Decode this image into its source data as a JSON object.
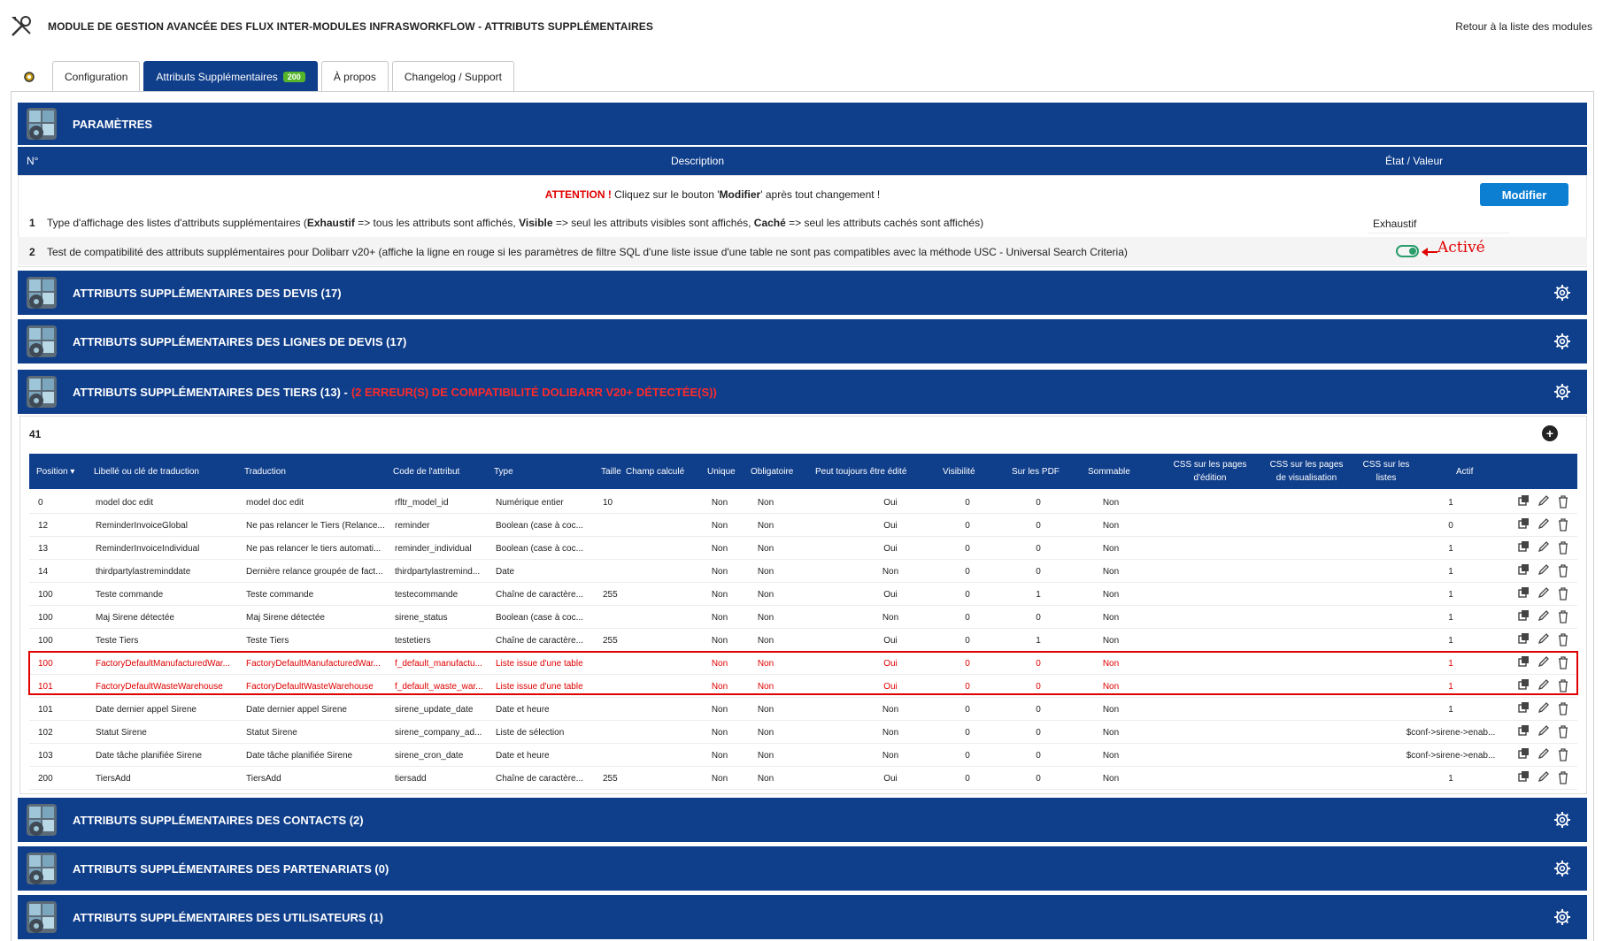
{
  "header": {
    "title": "MODULE DE GESTION AVANCÉE DES FLUX INTER-MODULES INFRASWORKFLOW - ATTRIBUTS SUPPLÉMENTAIRES",
    "back_link": "Retour à la liste des modules"
  },
  "tabs": [
    {
      "label": "Configuration"
    },
    {
      "label": "Attributs Supplémentaires",
      "badge": "200"
    },
    {
      "label": "À propos"
    },
    {
      "label": "Changelog / Support"
    }
  ],
  "params": {
    "title": "PARAMÈTRES",
    "col_num": "N°",
    "col_desc": "Description",
    "col_state": "État / Valeur",
    "attention_prefix": "ATTENTION !",
    "attention_a": " Cliquez sur le bouton '",
    "attention_b": "Modifier",
    "attention_c": "' après tout changement !",
    "modify_button": "Modifier",
    "row1": {
      "num": "1",
      "p1": "Type d'affichage des listes d'attributs supplémentaires (",
      "b1": "Exhaustif",
      "p2": " => tous les attributs sont affichés, ",
      "b2": "Visible",
      "p3": " => seul les attributs visibles sont affichés, ",
      "b3": "Caché",
      "p4": " => seul les attributs cachés sont affichés)",
      "value": "Exhaustif"
    },
    "row2": {
      "num": "2",
      "desc": "Test de compatibilité des attributs supplémentaires pour Dolibarr v20+ (affiche la ligne en rouge si les paramètres de filtre SQL d'une liste issue d'une table ne sont pas compatibles avec la méthode USC - Universal Search Criteria)",
      "annotation": "Activé"
    }
  },
  "sections": {
    "devis": "ATTRIBUTS SUPPLÉMENTAIRES DES DEVIS (17)",
    "lignes_devis": "ATTRIBUTS SUPPLÉMENTAIRES DES LIGNES DE DEVIS (17)",
    "tiers": "ATTRIBUTS SUPPLÉMENTAIRES DES TIERS (13) -",
    "tiers_error": "(2 ERREUR(S) DE COMPATIBILITÉ DOLIBARR V20+ DÉTECTÉE(S))",
    "contacts": "ATTRIBUTS SUPPLÉMENTAIRES DES CONTACTS (2)",
    "partenariats": "ATTRIBUTS SUPPLÉMENTAIRES DES PARTENARIATS (0)",
    "utilisateurs": "ATTRIBUTS SUPPLÉMENTAIRES DES UTILISATEURS (1)"
  },
  "tiers_table": {
    "count": "41",
    "headers": {
      "position": "Position",
      "libelle": "Libellé ou clé de traduction",
      "traduction": "Traduction",
      "code": "Code de l'attribut",
      "type": "Type",
      "taille": "Taille",
      "calcule": "Champ calculé",
      "unique": "Unique",
      "obligatoire": "Obligatoire",
      "toujours": "Peut toujours être édité",
      "visibilite": "Visibilité",
      "pdf": "Sur les PDF",
      "sommable": "Sommable",
      "css_edit_1": "CSS sur les pages",
      "css_edit_2": "d'édition",
      "css_view_1": "CSS sur les pages",
      "css_view_2": "de visualisation",
      "css_list_1": "CSS sur les",
      "css_list_2": "listes",
      "actif": "Actif"
    },
    "rows": [
      {
        "pos": "0",
        "label": "model doc edit",
        "trad": "model doc edit",
        "code": "rfltr_model_id",
        "type": "Numérique entier",
        "size": "10",
        "unique": "Non",
        "required": "Non",
        "always": "Oui",
        "vis": "0",
        "pdf": "0",
        "sum": "Non",
        "css": "",
        "active": "1",
        "error": false
      },
      {
        "pos": "12",
        "label": "ReminderInvoiceGlobal",
        "trad": "Ne pas relancer le Tiers (Relance...",
        "code": "reminder",
        "type": "Boolean (case à coc...",
        "size": "",
        "unique": "Non",
        "required": "Non",
        "always": "Oui",
        "vis": "0",
        "pdf": "0",
        "sum": "Non",
        "css": "",
        "active": "0",
        "error": false
      },
      {
        "pos": "13",
        "label": "ReminderInvoiceIndividual",
        "trad": "Ne pas relancer le tiers automati...",
        "code": "reminder_individual",
        "type": "Boolean (case à coc...",
        "size": "",
        "unique": "Non",
        "required": "Non",
        "always": "Oui",
        "vis": "0",
        "pdf": "0",
        "sum": "Non",
        "css": "",
        "active": "1",
        "error": false
      },
      {
        "pos": "14",
        "label": "thirdpartylastreminddate",
        "trad": "Dernière relance groupée de fact...",
        "code": "thirdpartylastremind...",
        "type": "Date",
        "size": "",
        "unique": "Non",
        "required": "Non",
        "always": "Non",
        "vis": "0",
        "pdf": "0",
        "sum": "Non",
        "css": "",
        "active": "1",
        "error": false
      },
      {
        "pos": "100",
        "label": "Teste commande",
        "trad": "Teste commande",
        "code": "testecommande",
        "type": "Chaîne de caractère...",
        "size": "255",
        "unique": "Non",
        "required": "Non",
        "always": "Oui",
        "vis": "0",
        "pdf": "1",
        "sum": "Non",
        "css": "",
        "active": "1",
        "error": false
      },
      {
        "pos": "100",
        "label": "Maj Sirene détectée",
        "trad": "Maj Sirene détectée",
        "code": "sirene_status",
        "type": "Boolean (case à coc...",
        "size": "",
        "unique": "Non",
        "required": "Non",
        "always": "Non",
        "vis": "0",
        "pdf": "0",
        "sum": "Non",
        "css": "",
        "active": "1",
        "error": false
      },
      {
        "pos": "100",
        "label": "Teste Tiers",
        "trad": "Teste Tiers",
        "code": "testetiers",
        "type": "Chaîne de caractère...",
        "size": "255",
        "unique": "Non",
        "required": "Non",
        "always": "Oui",
        "vis": "0",
        "pdf": "1",
        "sum": "Non",
        "css": "",
        "active": "1",
        "error": false
      },
      {
        "pos": "100",
        "label": "FactoryDefaultManufacturedWar...",
        "trad": "FactoryDefaultManufacturedWar...",
        "code": "f_default_manufactu...",
        "type": "Liste issue d'une table",
        "size": "",
        "unique": "Non",
        "required": "Non",
        "always": "Oui",
        "vis": "0",
        "pdf": "0",
        "sum": "Non",
        "css": "",
        "active": "1",
        "error": true
      },
      {
        "pos": "101",
        "label": "FactoryDefaultWasteWarehouse",
        "trad": "FactoryDefaultWasteWarehouse",
        "code": "f_default_waste_war...",
        "type": "Liste issue d'une table",
        "size": "",
        "unique": "Non",
        "required": "Non",
        "always": "Oui",
        "vis": "0",
        "pdf": "0",
        "sum": "Non",
        "css": "",
        "active": "1",
        "error": true
      },
      {
        "pos": "101",
        "label": "Date dernier appel Sirene",
        "trad": "Date dernier appel Sirene",
        "code": "sirene_update_date",
        "type": "Date et heure",
        "size": "",
        "unique": "Non",
        "required": "Non",
        "always": "Non",
        "vis": "0",
        "pdf": "0",
        "sum": "Non",
        "css": "",
        "active": "1",
        "error": false
      },
      {
        "pos": "102",
        "label": "Statut Sirene",
        "trad": "Statut Sirene",
        "code": "sirene_company_ad...",
        "type": "Liste de sélection",
        "size": "",
        "unique": "Non",
        "required": "Non",
        "always": "Non",
        "vis": "0",
        "pdf": "0",
        "sum": "Non",
        "css": "",
        "active": "$conf->sirene->enab...",
        "error": false
      },
      {
        "pos": "103",
        "label": "Date tâche planifiée Sirene",
        "trad": "Date tâche planifiée Sirene",
        "code": "sirene_cron_date",
        "type": "Date et heure",
        "size": "",
        "unique": "Non",
        "required": "Non",
        "always": "Non",
        "vis": "0",
        "pdf": "0",
        "sum": "Non",
        "css": "",
        "active": "$conf->sirene->enab...",
        "error": false
      },
      {
        "pos": "200",
        "label": "TiersAdd",
        "trad": "TiersAdd",
        "code": "tiersadd",
        "type": "Chaîne de caractère...",
        "size": "255",
        "unique": "Non",
        "required": "Non",
        "always": "Oui",
        "vis": "0",
        "pdf": "0",
        "sum": "Non",
        "css": "",
        "active": "1",
        "error": false
      }
    ]
  },
  "colors": {
    "primary": "#0f3e8b",
    "error": "#e00000",
    "button": "#0d7fd2",
    "badge": "#55b52b",
    "toggle": "#2a9d6b"
  },
  "icons": {
    "app": "tools-icon",
    "section": "module-cubes-icon",
    "settings": "gear-icon",
    "add": "plus-circle-icon",
    "clone": "clone-icon",
    "edit": "pencil-icon",
    "delete": "trash-icon"
  }
}
